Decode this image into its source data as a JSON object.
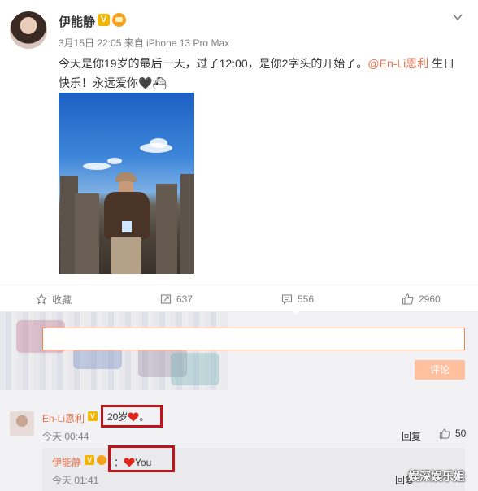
{
  "post": {
    "author": "伊能静",
    "verified_badge": "V",
    "meta": "3月15日 22:05 来自 iPhone 13 Pro Max",
    "text_before": "今天是你19岁的最后一天，过了12:00，是你2字头的开始了。",
    "mention": "@En-Li恩利",
    "text_after": " 生日快乐！永远爱你🖤⛴",
    "icons": {
      "menu": "chevron-down-icon",
      "verified": "verified-v-icon",
      "vip": "crown-icon"
    }
  },
  "actions": {
    "favorite_label": "收藏",
    "forward_count": "637",
    "comment_count": "556",
    "like_count": "2960"
  },
  "composer": {
    "input_value": "",
    "submit_label": "评论"
  },
  "comment": {
    "author": "En-Li恩利",
    "verified_badge": "V",
    "text": "20岁",
    "text_suffix": "。",
    "time": "今天 00:44",
    "reply_label": "回复",
    "like_count": "50"
  },
  "reply": {
    "author": "伊能静",
    "verified_badge": "V",
    "prefix": "：",
    "text": "You",
    "time": "今天 01:41",
    "reply_label": "回复"
  },
  "watermark": "娱深娱乐姐",
  "colors": {
    "accent": "#eb7350",
    "highlight": "#c0141b",
    "submit_disabled": "#ffc09f",
    "heart": "#e0251b"
  }
}
